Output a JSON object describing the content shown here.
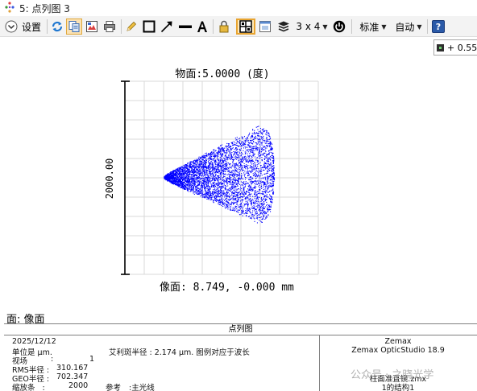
{
  "window": {
    "title": "5: 点列图 3"
  },
  "toolbar": {
    "settings_label": "设置",
    "layout_label": "3 x 4",
    "standard_label": "标准",
    "auto_label": "自动",
    "help_icon_text": "?"
  },
  "badge": {
    "value": "+ 0.55"
  },
  "plot": {
    "title": "物面:5.0000 (度)",
    "scale_label": "2000.00",
    "image_label": "像面: 8.749, -0.000 mm",
    "spot_color": "#0000ff",
    "grid_color": "#d9d9d9"
  },
  "surface_label": "面: 像面",
  "footer": {
    "header": "点列图",
    "date": "2025/12/12",
    "units": "单位是 µm.",
    "field_label": "视场",
    "field_sep": ":",
    "field_value": "1",
    "rms_label": "RMS半径 :",
    "rms_value": "310.167",
    "geo_label": "GEO半径 :",
    "geo_value": "702.347",
    "scale_label": "缩放条   :",
    "scale_value": "2000",
    "ref_label": "参考",
    "ref_value": ":主光线",
    "airy_text": "艾利斑半径 : 2.174 µm. 图例对应于波长",
    "brand": "Zemax",
    "product": "Zemax OpticStudio 18.9",
    "file": "柱面准直镜.zmx",
    "config": "1的结构1",
    "watermark": "公众号 · 之晓光学"
  }
}
